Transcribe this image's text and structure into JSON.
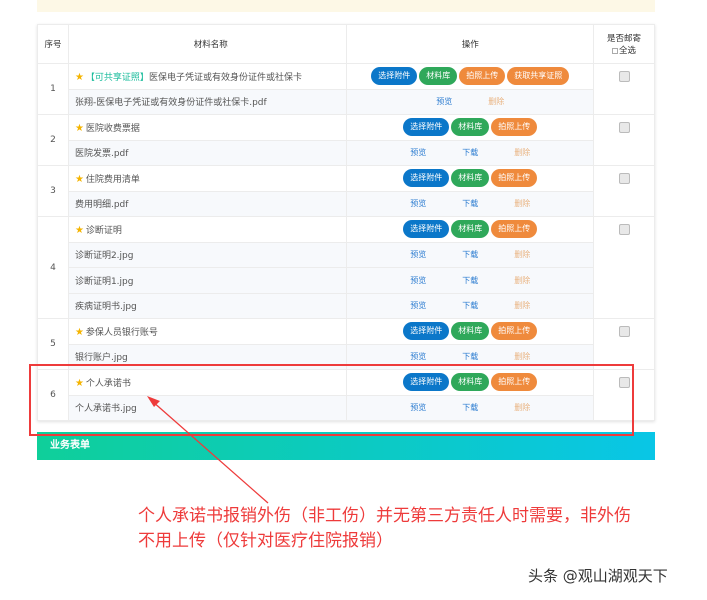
{
  "headers": {
    "index": "序号",
    "name": "材料名称",
    "ops": "操作",
    "mail": "是否邮寄",
    "select_all": "全选"
  },
  "buttons": {
    "select": "选择附件",
    "library": "材料库",
    "photo": "拍照上传",
    "share": "获取共享证照"
  },
  "links": {
    "preview": "预览",
    "download": "下载",
    "delete": "删除"
  },
  "rows": [
    {
      "index": "1",
      "tag": "【可共享证照】",
      "name": "医保电子凭证或有效身份证件或社保卡",
      "share": true,
      "files": [
        {
          "name": "张翔-医保电子凭证或有效身份证件或社保卡.pdf",
          "download": false
        }
      ]
    },
    {
      "index": "2",
      "name": "医院收费票据",
      "files": [
        {
          "name": "医院发票.pdf",
          "download": true
        }
      ]
    },
    {
      "index": "3",
      "name": "住院费用清单",
      "files": [
        {
          "name": "费用明细.pdf",
          "download": true
        }
      ]
    },
    {
      "index": "4",
      "name": "诊断证明",
      "files": [
        {
          "name": "诊断证明2.jpg",
          "download": true
        },
        {
          "name": "诊断证明1.jpg",
          "download": true
        },
        {
          "name": "疾病证明书.jpg",
          "download": true
        }
      ]
    },
    {
      "index": "5",
      "name": "参保人员银行账号",
      "files": [
        {
          "name": "银行账户.jpg",
          "download": true
        }
      ]
    },
    {
      "index": "6",
      "name": "个人承诺书",
      "files": [
        {
          "name": "个人承诺书.jpg",
          "download": true
        }
      ]
    }
  ],
  "section_title": "业务表单",
  "annotation": {
    "line1": "个人承诺书报销外伤（非工伤）并无第三方责任人时需要，非外伤",
    "line2": "不用上传（仅针对医疗住院报销）"
  },
  "watermark": "头条 @观山湖观天下",
  "colors": {
    "blue": "#0b77c9",
    "green": "#2fa85a",
    "orange": "#ef8a3c",
    "annotation": "#ee3b3b"
  }
}
